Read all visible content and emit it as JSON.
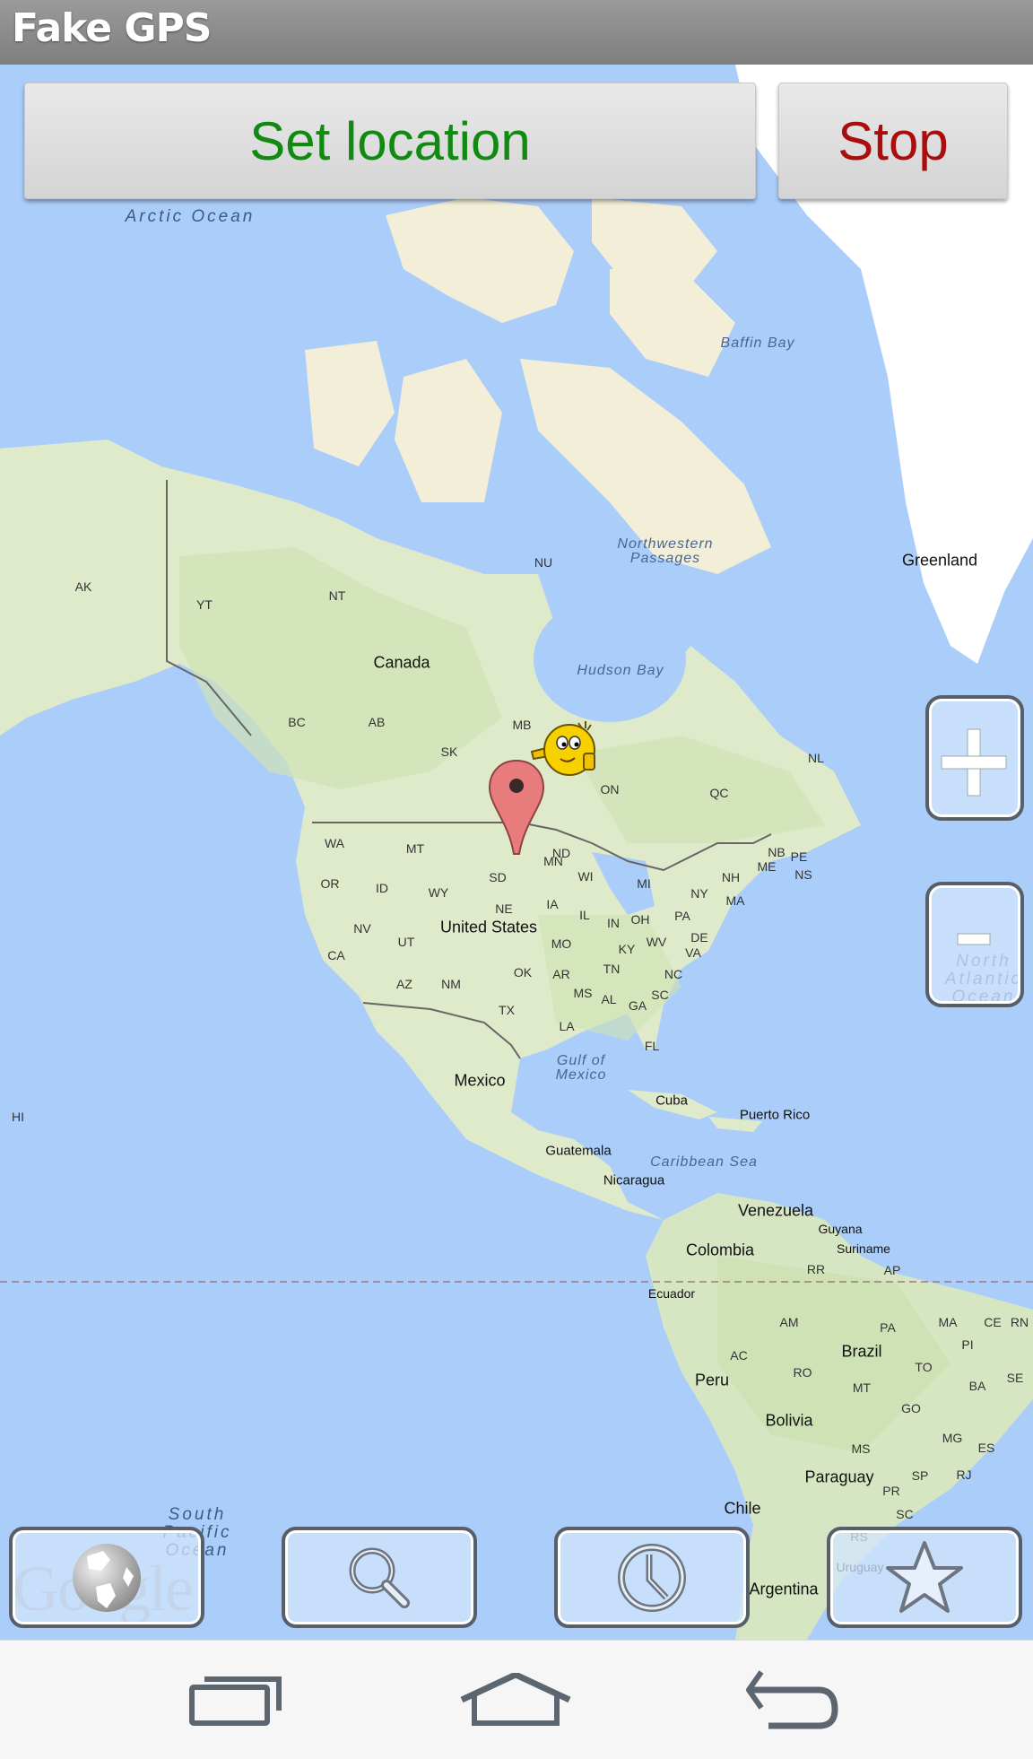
{
  "app": {
    "title": "Fake GPS"
  },
  "toolbar": {
    "set_location_label": "Set location",
    "stop_label": "Stop"
  },
  "colors": {
    "set_location": "#118a11",
    "stop": "#aa0d0d",
    "ocean": "#abcdfa",
    "land": "#e8efdc",
    "vegetation": "#cfe3b4",
    "marker": "#e87b7b"
  },
  "map": {
    "provider_logo": "Google",
    "marker": {
      "icon": "map-pin-icon",
      "near_label": "ND/MN"
    },
    "avatar": {
      "icon": "smiley-thumbs-up-icon"
    },
    "labels": {
      "oceans": [
        {
          "id": "arctic",
          "text": "Arctic Ocean"
        },
        {
          "id": "north-atlantic",
          "text": "North\nAtlantic\nOcean"
        },
        {
          "id": "south-pacific",
          "text": "South\nPacific\nOcean"
        }
      ],
      "water": [
        {
          "id": "baffin",
          "text": "Baffin Bay"
        },
        {
          "id": "nw-passages",
          "text": "Northwestern\nPassages"
        },
        {
          "id": "hudson",
          "text": "Hudson Bay"
        },
        {
          "id": "gulf-mexico",
          "text": "Gulf of\nMexico"
        },
        {
          "id": "caribbean",
          "text": "Caribbean Sea"
        }
      ],
      "countries": [
        {
          "id": "canada",
          "text": "Canada"
        },
        {
          "id": "greenland",
          "text": "Greenland"
        },
        {
          "id": "us",
          "text": "United States"
        },
        {
          "id": "mexico",
          "text": "Mexico"
        },
        {
          "id": "cuba",
          "text": "Cuba"
        },
        {
          "id": "puerto-rico",
          "text": "Puerto Rico"
        },
        {
          "id": "guatemala",
          "text": "Guatemala"
        },
        {
          "id": "nicaragua",
          "text": "Nicaragua"
        },
        {
          "id": "venezuela",
          "text": "Venezuela"
        },
        {
          "id": "colombia",
          "text": "Colombia"
        },
        {
          "id": "guyana",
          "text": "Guyana"
        },
        {
          "id": "suriname",
          "text": "Suriname"
        },
        {
          "id": "ecuador",
          "text": "Ecuador"
        },
        {
          "id": "peru",
          "text": "Peru"
        },
        {
          "id": "brazil",
          "text": "Brazil"
        },
        {
          "id": "bolivia",
          "text": "Bolivia"
        },
        {
          "id": "paraguay",
          "text": "Paraguay"
        },
        {
          "id": "chile",
          "text": "Chile"
        },
        {
          "id": "argentina",
          "text": "Argentina"
        },
        {
          "id": "uruguay",
          "text": "Uruguay"
        }
      ],
      "regions": [
        "AK",
        "YT",
        "NT",
        "NU",
        "BC",
        "AB",
        "SK",
        "MB",
        "ON",
        "QC",
        "NL",
        "NB",
        "PE",
        "NS",
        "WA",
        "MT",
        "ND",
        "MN",
        "OR",
        "ID",
        "WY",
        "SD",
        "WI",
        "MI",
        "NY",
        "ME",
        "NH",
        "MA",
        "NE",
        "IA",
        "IL",
        "IN",
        "OH",
        "PA",
        "NV",
        "UT",
        "CA",
        "MO",
        "KY",
        "WV",
        "VA",
        "DE",
        "AZ",
        "NM",
        "OK",
        "AR",
        "TN",
        "NC",
        "MS",
        "AL",
        "GA",
        "SC",
        "TX",
        "LA",
        "FL",
        "HI",
        "RR",
        "AP",
        "AM",
        "PA",
        "MA",
        "CE",
        "RN",
        "PI",
        "AC",
        "RO",
        "MT",
        "TO",
        "BA",
        "SE",
        "GO",
        "MG",
        "ES",
        "MS",
        "SP",
        "RJ",
        "PR",
        "SC",
        "RS"
      ]
    }
  },
  "zoom": {
    "in_icon": "plus-icon",
    "out_icon": "minus-icon"
  },
  "bottom_buttons": [
    {
      "id": "map-type",
      "icon": "globe-icon"
    },
    {
      "id": "search",
      "icon": "search-icon"
    },
    {
      "id": "history",
      "icon": "clock-icon"
    },
    {
      "id": "favorites",
      "icon": "star-icon"
    }
  ],
  "navbar": [
    {
      "id": "recents",
      "icon": "recent-apps-icon"
    },
    {
      "id": "home",
      "icon": "home-icon"
    },
    {
      "id": "back",
      "icon": "back-icon"
    }
  ]
}
